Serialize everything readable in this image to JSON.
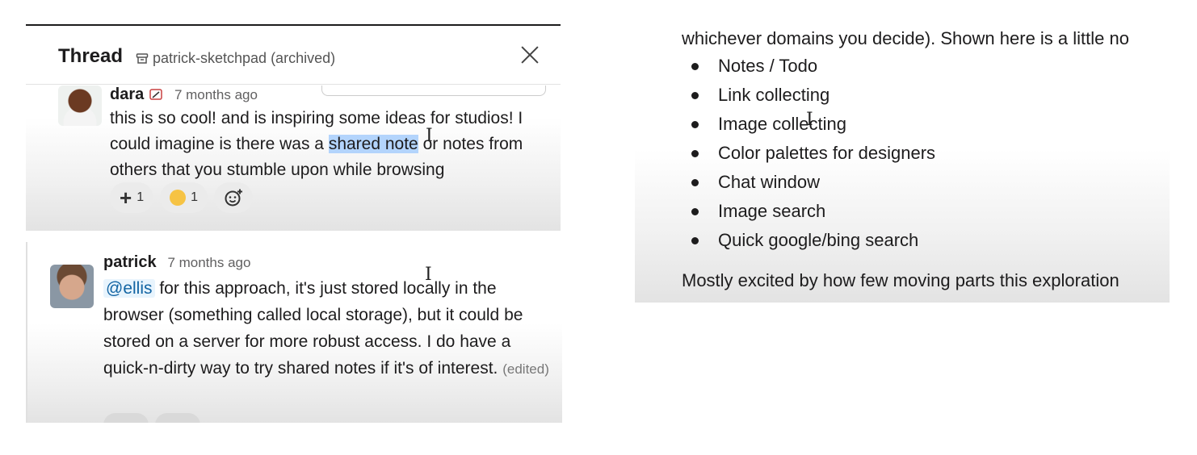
{
  "thread": {
    "title": "Thread",
    "channel": "patrick-sketchpad (archived)",
    "close_icon": "close-icon"
  },
  "message_dara": {
    "author": "dara",
    "time": "7 months ago",
    "text_before": "this is so cool! and is inspiring some ideas for studios! I could imagine is there was a ",
    "text_highlight": "shared note",
    "text_after": " or notes from others that you stumble upon while browsing",
    "reactions": [
      {
        "icon": "plus-icon",
        "count": "1"
      },
      {
        "icon": "emoji-face-icon",
        "count": "1"
      },
      {
        "icon": "add-reaction-icon"
      }
    ]
  },
  "message_patrick": {
    "author": "patrick",
    "time": "7 months ago",
    "mention": "@ellis",
    "text": " for this approach, it's just stored locally in the browser (something called local storage), but it could be stored on a server for more robust access.  I do have a quick-n-dirty way to try shared notes if it's of interest.",
    "edited": "(edited)"
  },
  "notes": {
    "intro": "whichever domains you decide).  Shown here is a little no",
    "items": [
      "Notes / Todo",
      "Link collecting",
      "Image collecting",
      "Color palettes for designers",
      "Chat window",
      "Image search",
      "Quick google/bing search"
    ],
    "footer": "Mostly excited by how few moving parts this exploration"
  },
  "colors": {
    "highlight": "#b3d4fc",
    "mention_bg": "#e8f4fd",
    "mention_text": "#1264a3"
  }
}
